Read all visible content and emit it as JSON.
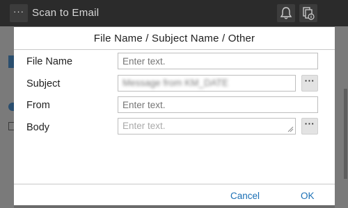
{
  "app_bar": {
    "title": "Scan to Email",
    "menu_icon": "ellipsis-icon",
    "notification_icon": "bell-icon",
    "info_icon": "device-info-icon"
  },
  "dialog": {
    "title": "File Name / Subject Name / Other",
    "fields": [
      {
        "label": "File Name",
        "value": "",
        "placeholder": "Enter text."
      },
      {
        "label": "Subject",
        "value": "Message from KM_DATE",
        "placeholder": ""
      },
      {
        "label": "From",
        "value": "",
        "placeholder": "Enter text."
      },
      {
        "label": "Body",
        "value": "",
        "placeholder": "Enter text."
      }
    ],
    "more_button_label": "···",
    "cancel_label": "Cancel",
    "ok_label": "OK"
  },
  "colors": {
    "accent": "#1a6fb5",
    "topbar": "#2b2b2b",
    "dialog_bg": "#ffffff"
  }
}
